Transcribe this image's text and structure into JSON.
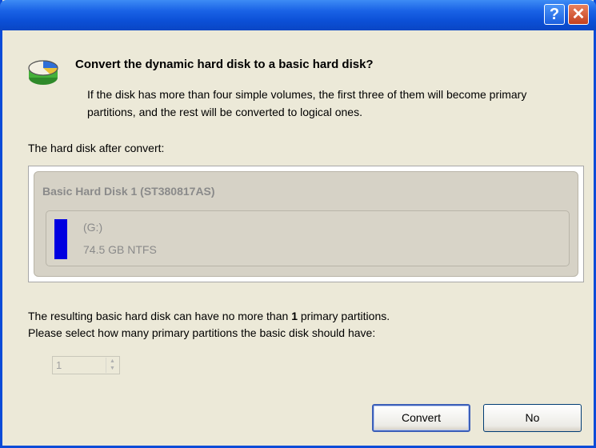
{
  "titlebar": {
    "help_label": "?",
    "close_label": "✕"
  },
  "header": {
    "icon": "disk-icon",
    "title": "Convert the dynamic hard disk to a basic hard disk?",
    "description": "If the disk has more than four simple volumes, the first three of them will become primary partitions, and the rest will be converted to logical ones."
  },
  "disk_section": {
    "label": "The hard disk after convert:",
    "disk_name": "Basic Hard Disk 1 (ST380817AS)",
    "partition": {
      "letter": "(G:)",
      "info": "74.5 GB NTFS",
      "color": "#0000e0"
    }
  },
  "note": {
    "line1_prefix": "The resulting basic hard disk can have no more than ",
    "line1_count": "1",
    "line1_suffix": " primary partitions.",
    "line2": "Please select how many primary partitions the basic disk should have:"
  },
  "spinner": {
    "value": "1"
  },
  "buttons": {
    "convert": "Convert",
    "no": "No"
  }
}
